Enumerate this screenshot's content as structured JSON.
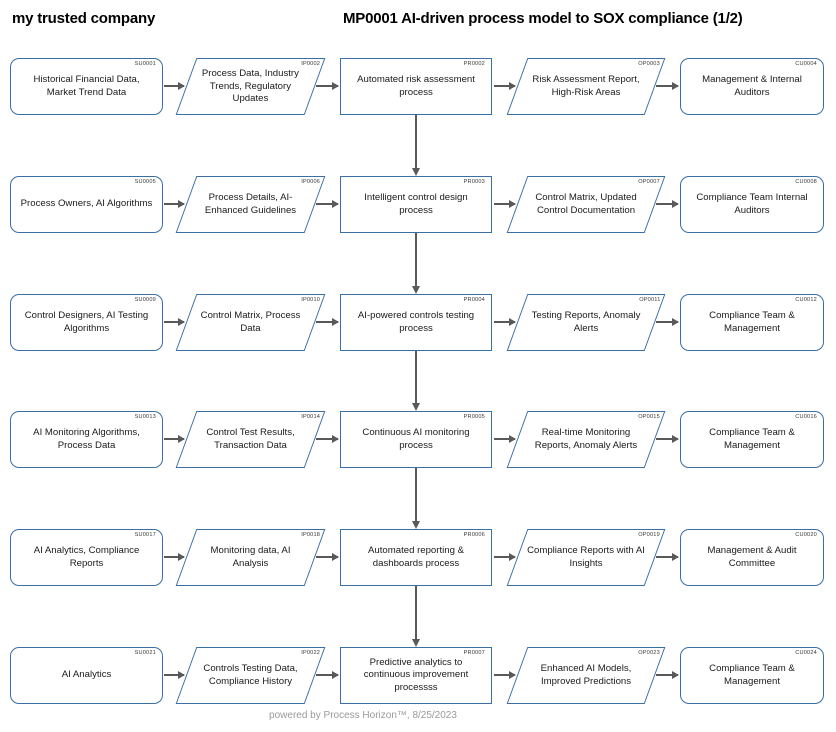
{
  "header": {
    "company": "my trusted company",
    "title": "MP0001 AI-driven process model to SOX compliance (1/2)"
  },
  "theme": {
    "shape_border": "#3a6ea5",
    "arrow_color": "#595959",
    "background": "#ffffff",
    "footer_color": "#9a9a9a"
  },
  "columns": [
    "supplier",
    "input",
    "process",
    "output",
    "customer"
  ],
  "rows": [
    {
      "supplier": {
        "id": "SU0001",
        "label": "Historical Financial Data, Market Trend Data"
      },
      "input": {
        "id": "IP0002",
        "label": "Process Data, Industry Trends, Regulatory Updates"
      },
      "process": {
        "id": "PR0002",
        "label": "Automated risk assessment process"
      },
      "output": {
        "id": "OP0003",
        "label": "Risk Assessment Report, High-Risk Areas"
      },
      "customer": {
        "id": "CU0004",
        "label": "Management & Internal Auditors"
      }
    },
    {
      "supplier": {
        "id": "SU0005",
        "label": "Process Owners, AI Algorithms"
      },
      "input": {
        "id": "IP0006",
        "label": "Process Details, AI-Enhanced Guidelines"
      },
      "process": {
        "id": "PR0003",
        "label": "Intelligent control design process"
      },
      "output": {
        "id": "OP0007",
        "label": "Control Matrix, Updated Control Documentation"
      },
      "customer": {
        "id": "CU0008",
        "label": "Compliance Team Internal Auditors"
      }
    },
    {
      "supplier": {
        "id": "SU0009",
        "label": "Control Designers, AI Testing Algorithms"
      },
      "input": {
        "id": "IP0010",
        "label": "Control Matrix, Process Data"
      },
      "process": {
        "id": "PR0004",
        "label": "AI-powered controls testing process"
      },
      "output": {
        "id": "OP0011",
        "label": "Testing Reports, Anomaly Alerts"
      },
      "customer": {
        "id": "CU0012",
        "label": "Compliance Team & Management"
      }
    },
    {
      "supplier": {
        "id": "SU0013",
        "label": "AI Monitoring Algorithms, Process Data"
      },
      "input": {
        "id": "IP0014",
        "label": "Control Test Results, Transaction Data"
      },
      "process": {
        "id": "PR0005",
        "label": "Continuous AI monitoring process"
      },
      "output": {
        "id": "OP0015",
        "label": "Real-time Monitoring Reports, Anomaly Alerts"
      },
      "customer": {
        "id": "CU0016",
        "label": "Compliance Team & Management"
      }
    },
    {
      "supplier": {
        "id": "SU0017",
        "label": "AI Analytics, Compliance Reports"
      },
      "input": {
        "id": "IP0018",
        "label": "Monitoring data, AI Analysis"
      },
      "process": {
        "id": "PR0006",
        "label": "Automated reporting & dashboards process"
      },
      "output": {
        "id": "OP0019",
        "label": "Compliance Reports with AI Insights"
      },
      "customer": {
        "id": "CU0020",
        "label": "Management & Audit Committee"
      }
    },
    {
      "supplier": {
        "id": "SU0021",
        "label": "AI Analytics"
      },
      "input": {
        "id": "IP0022",
        "label": "Controls Testing Data, Compliance History"
      },
      "process": {
        "id": "PR0007",
        "label": "Predictive analytics to continuous improvement processss"
      },
      "output": {
        "id": "OP0023",
        "label": "Enhanced AI Models, Improved Predictions"
      },
      "customer": {
        "id": "CU0024",
        "label": "Compliance Team & Management"
      }
    }
  ],
  "footer": {
    "text": "powered by Process Horizon™, 8/25/2023"
  }
}
